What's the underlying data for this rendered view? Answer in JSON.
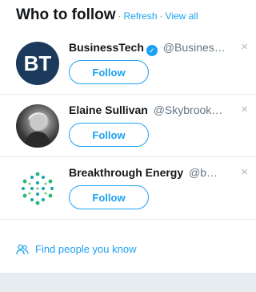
{
  "header": {
    "title": "Who to follow",
    "separator": "·",
    "refresh_label": "Refresh",
    "view_all_label": "View all"
  },
  "suggestions": [
    {
      "name": "BusinessTech",
      "verified": true,
      "handle": "@Busines…",
      "avatar_text": "BT",
      "follow_label": "Follow",
      "dismiss": "×"
    },
    {
      "name": "Elaine Sullivan",
      "verified": false,
      "handle": "@Skybrook…",
      "follow_label": "Follow",
      "dismiss": "×"
    },
    {
      "name": "Breakthrough Energy",
      "verified": false,
      "handle": "@b…",
      "follow_label": "Follow",
      "dismiss": "×"
    }
  ],
  "footer": {
    "find_people_label": "Find people you know"
  },
  "colors": {
    "accent": "#1da1f2",
    "bt_avatar": "#1b3a5c",
    "be_logo_green": "#2bb673",
    "be_logo_teal": "#1aa3a8"
  }
}
